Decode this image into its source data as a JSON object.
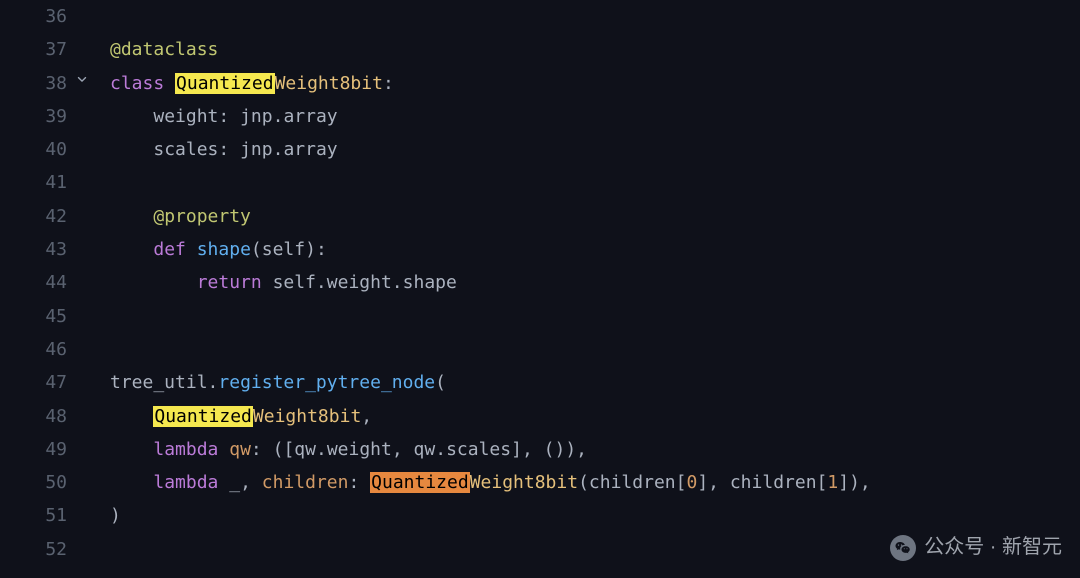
{
  "gutter": {
    "numbers": [
      "36",
      "37",
      "38",
      "39",
      "40",
      "41",
      "42",
      "43",
      "44",
      "45",
      "46",
      "47",
      "48",
      "49",
      "50",
      "51",
      "52"
    ],
    "fold_line_index": 2
  },
  "tokens": {
    "at": "@",
    "dataclass": "dataclass",
    "class": "class ",
    "quantized": "Quantized",
    "weight8bit": "Weight8bit",
    "colon": ":",
    "weight_field": "weight",
    "scales_field": "scales",
    "jnp": "jnp",
    "dot": ".",
    "array": "array",
    "property": "property",
    "def": "def ",
    "shape": "shape",
    "self": "self",
    "return": "return ",
    "weight_attr": "weight",
    "shape_attr": "shape",
    "tree_util": "tree_util",
    "register_pytree_node": "register_pytree_node",
    "lparen": "(",
    "rparen": ")",
    "comma": ",",
    "lambda": "lambda",
    "qw": "qw",
    "lbracket": "[",
    "rbracket": "]",
    "empty_tuple": "()",
    "underscore": "_",
    "children": "children",
    "zero": "0",
    "one": "1"
  },
  "watermark": {
    "label": "公众号 · 新智元"
  }
}
